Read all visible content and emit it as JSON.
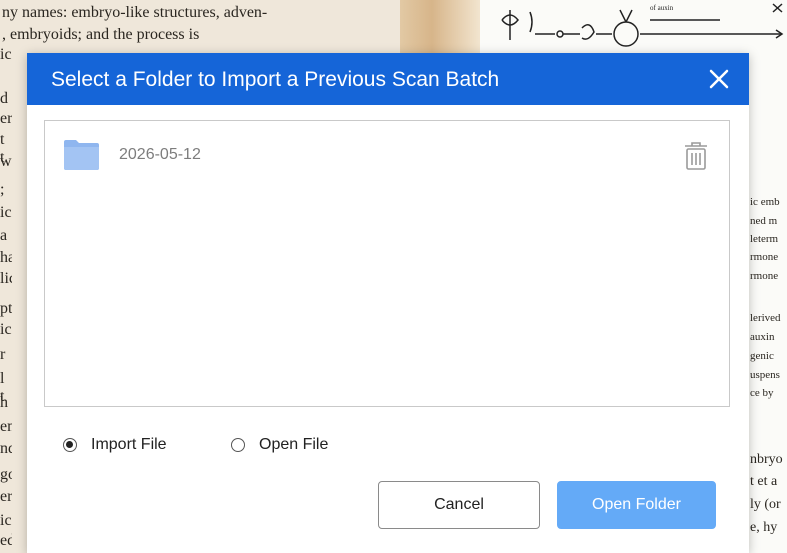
{
  "background": {
    "page_lines": [
      "ny names: embryo-like structures, adven-",
      ", embryoids; and the process is"
    ],
    "side_chars": [
      "ic",
      "d",
      "er",
      "t t",
      "w",
      ";",
      "ic",
      "a",
      "ha",
      "lic",
      "pt",
      "ic",
      "r",
      "l t",
      "h",
      "en",
      "nd",
      "go",
      "er",
      "ic",
      "ed"
    ],
    "right_column_lines": [
      "ic emb",
      "ned m",
      "leterm",
      "rmone",
      "rmone",
      "lerived",
      "auxin",
      "genic",
      "uspens",
      "ce by",
      "nbryo",
      "t et a",
      "ly (or",
      "e, hy"
    ],
    "diagram_labels": [
      "of auxin"
    ]
  },
  "dialog": {
    "title": "Select a Folder to Import a Previous Scan Batch",
    "close_icon": "close-icon",
    "folders": [
      {
        "name": "2026-05-12",
        "icon": "folder-icon",
        "action_icon": "trash-icon"
      }
    ],
    "options": [
      {
        "label": "Import File",
        "selected": true
      },
      {
        "label": "Open File",
        "selected": false
      }
    ],
    "buttons": {
      "cancel_label": "Cancel",
      "open_label": "Open Folder"
    },
    "colors": {
      "header": "#1565d8",
      "primary_button": "#64aaf7",
      "folder": "#8fb6ef"
    }
  }
}
